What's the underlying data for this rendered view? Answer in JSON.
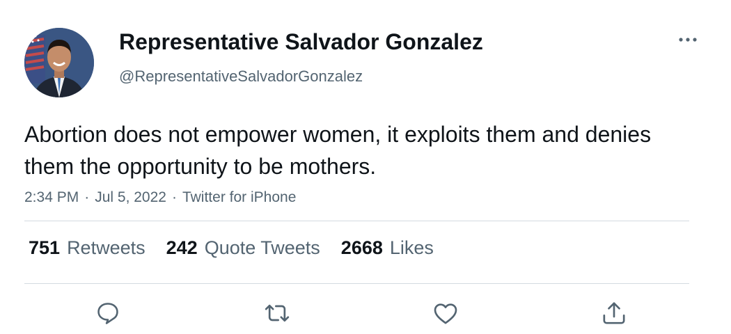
{
  "author": {
    "display_name": "Representative Salvador Gonzalez",
    "handle": "@RepresentativeSalvadorGonzalez",
    "avatar": "profile-photo"
  },
  "tweet": {
    "text": "Abortion does not empower women, it exploits them and denies them the opportunity to be mothers.",
    "time": "2:34 PM",
    "date": "Jul 5, 2022",
    "source": "Twitter for iPhone",
    "separator": "·"
  },
  "stats": [
    {
      "count": "751",
      "label": "Retweets"
    },
    {
      "count": "242",
      "label": "Quote Tweets"
    },
    {
      "count": "2668",
      "label": "Likes"
    }
  ],
  "actions": [
    "reply-icon",
    "retweet-icon",
    "like-icon",
    "share-icon"
  ],
  "colors": {
    "text": "#0f1419",
    "secondary": "#536471",
    "divider": "#d4dbe1"
  }
}
